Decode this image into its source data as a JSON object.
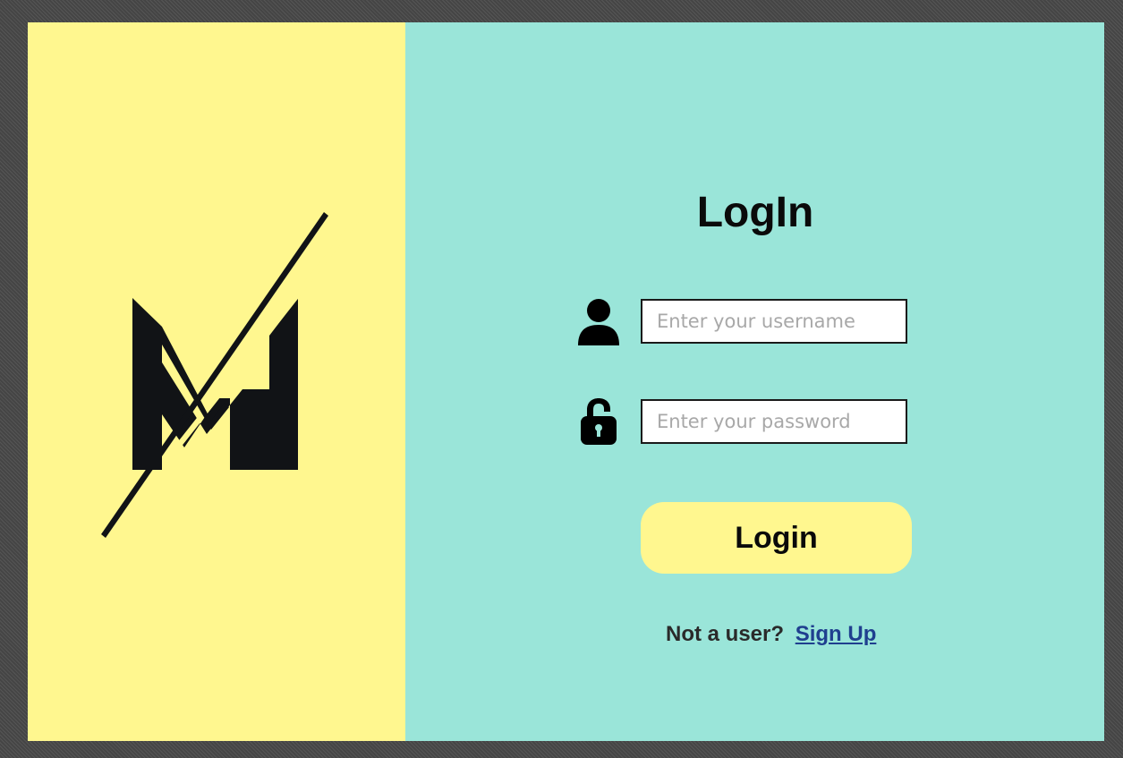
{
  "brand": {
    "logo_letter": "M",
    "icon": "brand-logo-icon",
    "background_color": "#fff78f"
  },
  "login_panel": {
    "title": "LogIn",
    "background_color": "#9ae5d9",
    "username": {
      "icon": "user-icon",
      "value": "",
      "placeholder": "Enter your username"
    },
    "password": {
      "icon": "lock-icon",
      "value": "",
      "placeholder": "Enter your password"
    },
    "login_button_label": "Login",
    "login_button_color": "#fff78f",
    "signup_prompt": "Not a user?",
    "signup_link": "Sign Up"
  }
}
